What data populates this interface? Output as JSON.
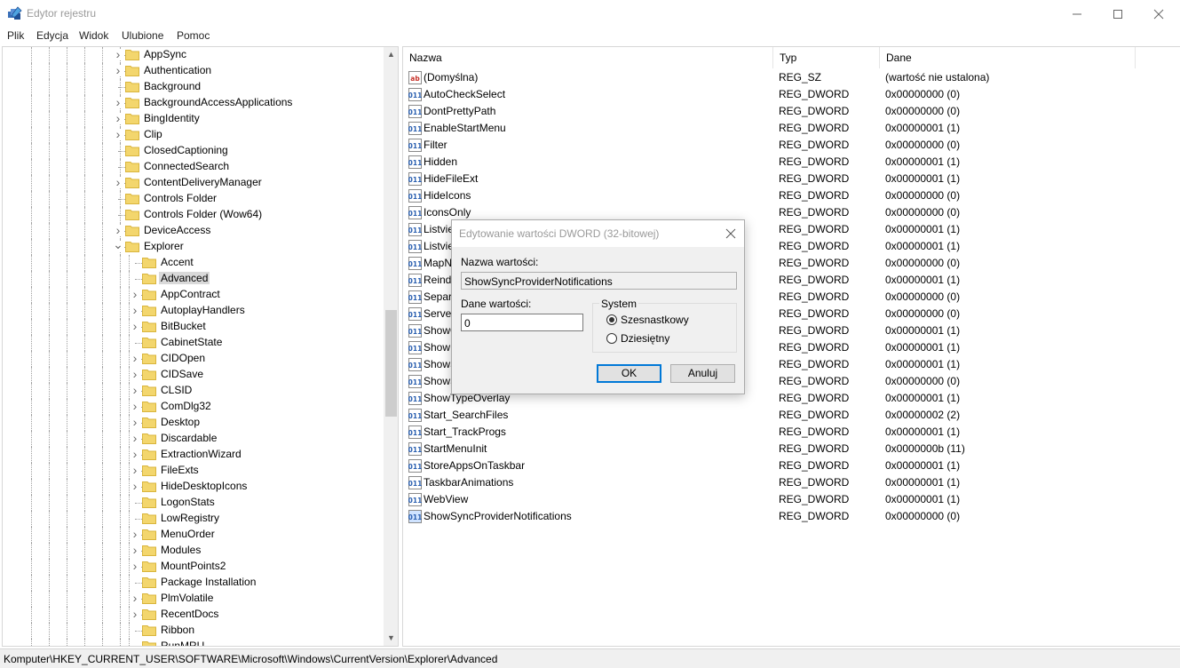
{
  "window": {
    "title": "Edytor rejestru",
    "controls": {
      "minimize_icon": "minimize-icon",
      "maximize_icon": "maximize-icon",
      "close_icon": "close-icon"
    }
  },
  "menu": [
    "Plik",
    "Edycja",
    "Widok",
    "Ulubione",
    "Pomoc"
  ],
  "tree": {
    "items": [
      {
        "label": "AppSync",
        "level": 0,
        "expander": "collapsed"
      },
      {
        "label": "Authentication",
        "level": 0,
        "expander": "collapsed"
      },
      {
        "label": "Background",
        "level": 0,
        "expander": "none"
      },
      {
        "label": "BackgroundAccessApplications",
        "level": 0,
        "expander": "collapsed"
      },
      {
        "label": "BingIdentity",
        "level": 0,
        "expander": "collapsed"
      },
      {
        "label": "Clip",
        "level": 0,
        "expander": "collapsed"
      },
      {
        "label": "ClosedCaptioning",
        "level": 0,
        "expander": "none"
      },
      {
        "label": "ConnectedSearch",
        "level": 0,
        "expander": "none"
      },
      {
        "label": "ContentDeliveryManager",
        "level": 0,
        "expander": "collapsed"
      },
      {
        "label": "Controls Folder",
        "level": 0,
        "expander": "none"
      },
      {
        "label": "Controls Folder (Wow64)",
        "level": 0,
        "expander": "none"
      },
      {
        "label": "DeviceAccess",
        "level": 0,
        "expander": "collapsed"
      },
      {
        "label": "Explorer",
        "level": 0,
        "expander": "expanded"
      },
      {
        "label": "Accent",
        "level": 1,
        "expander": "none"
      },
      {
        "label": "Advanced",
        "level": 1,
        "expander": "none",
        "selected": true
      },
      {
        "label": "AppContract",
        "level": 1,
        "expander": "collapsed"
      },
      {
        "label": "AutoplayHandlers",
        "level": 1,
        "expander": "collapsed"
      },
      {
        "label": "BitBucket",
        "level": 1,
        "expander": "collapsed"
      },
      {
        "label": "CabinetState",
        "level": 1,
        "expander": "none"
      },
      {
        "label": "CIDOpen",
        "level": 1,
        "expander": "collapsed"
      },
      {
        "label": "CIDSave",
        "level": 1,
        "expander": "collapsed"
      },
      {
        "label": "CLSID",
        "level": 1,
        "expander": "collapsed"
      },
      {
        "label": "ComDlg32",
        "level": 1,
        "expander": "collapsed"
      },
      {
        "label": "Desktop",
        "level": 1,
        "expander": "collapsed"
      },
      {
        "label": "Discardable",
        "level": 1,
        "expander": "collapsed"
      },
      {
        "label": "ExtractionWizard",
        "level": 1,
        "expander": "collapsed"
      },
      {
        "label": "FileExts",
        "level": 1,
        "expander": "collapsed"
      },
      {
        "label": "HideDesktopIcons",
        "level": 1,
        "expander": "collapsed"
      },
      {
        "label": "LogonStats",
        "level": 1,
        "expander": "none"
      },
      {
        "label": "LowRegistry",
        "level": 1,
        "expander": "none"
      },
      {
        "label": "MenuOrder",
        "level": 1,
        "expander": "collapsed"
      },
      {
        "label": "Modules",
        "level": 1,
        "expander": "collapsed"
      },
      {
        "label": "MountPoints2",
        "level": 1,
        "expander": "collapsed"
      },
      {
        "label": "Package Installation",
        "level": 1,
        "expander": "none"
      },
      {
        "label": "PlmVolatile",
        "level": 1,
        "expander": "collapsed"
      },
      {
        "label": "RecentDocs",
        "level": 1,
        "expander": "collapsed"
      },
      {
        "label": "Ribbon",
        "level": 1,
        "expander": "none"
      },
      {
        "label": "RunMRU",
        "level": 1,
        "expander": "none"
      }
    ],
    "scroll_up_icon": "scroll-up-arrow-icon",
    "scroll_down_icon": "scroll-down-arrow-icon"
  },
  "list": {
    "columns": {
      "name": "Nazwa",
      "type": "Typ",
      "data": "Dane"
    },
    "rows": [
      {
        "name": "(Domyślna)",
        "type": "REG_SZ",
        "data": "(wartość nie ustalona)",
        "icon": "string-value-icon"
      },
      {
        "name": "AutoCheckSelect",
        "type": "REG_DWORD",
        "data": "0x00000000 (0)",
        "icon": "binary-value-icon"
      },
      {
        "name": "DontPrettyPath",
        "type": "REG_DWORD",
        "data": "0x00000000 (0)",
        "icon": "binary-value-icon"
      },
      {
        "name": "EnableStartMenu",
        "type": "REG_DWORD",
        "data": "0x00000001 (1)",
        "icon": "binary-value-icon"
      },
      {
        "name": "Filter",
        "type": "REG_DWORD",
        "data": "0x00000000 (0)",
        "icon": "binary-value-icon"
      },
      {
        "name": "Hidden",
        "type": "REG_DWORD",
        "data": "0x00000001 (1)",
        "icon": "binary-value-icon"
      },
      {
        "name": "HideFileExt",
        "type": "REG_DWORD",
        "data": "0x00000001 (1)",
        "icon": "binary-value-icon"
      },
      {
        "name": "HideIcons",
        "type": "REG_DWORD",
        "data": "0x00000000 (0)",
        "icon": "binary-value-icon"
      },
      {
        "name": "IconsOnly",
        "type": "REG_DWORD",
        "data": "0x00000000 (0)",
        "icon": "binary-value-icon"
      },
      {
        "name": "Listvie",
        "type": "REG_DWORD",
        "data": "0x00000001 (1)",
        "icon": "binary-value-icon"
      },
      {
        "name": "Listvie",
        "type": "REG_DWORD",
        "data": "0x00000001 (1)",
        "icon": "binary-value-icon"
      },
      {
        "name": "MapN",
        "type": "REG_DWORD",
        "data": "0x00000000 (0)",
        "icon": "binary-value-icon"
      },
      {
        "name": "Reind",
        "type": "REG_DWORD",
        "data": "0x00000001 (1)",
        "icon": "binary-value-icon"
      },
      {
        "name": "Separa",
        "type": "REG_DWORD",
        "data": "0x00000000 (0)",
        "icon": "binary-value-icon"
      },
      {
        "name": "Server",
        "type": "REG_DWORD",
        "data": "0x00000000 (0)",
        "icon": "binary-value-icon"
      },
      {
        "name": "ShowC",
        "type": "REG_DWORD",
        "data": "0x00000001 (1)",
        "icon": "binary-value-icon"
      },
      {
        "name": "ShowI",
        "type": "REG_DWORD",
        "data": "0x00000001 (1)",
        "icon": "binary-value-icon"
      },
      {
        "name": "ShowS",
        "type": "REG_DWORD",
        "data": "0x00000001 (1)",
        "icon": "binary-value-icon"
      },
      {
        "name": "ShowS",
        "type": "REG_DWORD",
        "data": "0x00000000 (0)",
        "icon": "binary-value-icon"
      },
      {
        "name": "ShowTypeOverlay",
        "type": "REG_DWORD",
        "data": "0x00000001 (1)",
        "icon": "binary-value-icon"
      },
      {
        "name": "Start_SearchFiles",
        "type": "REG_DWORD",
        "data": "0x00000002 (2)",
        "icon": "binary-value-icon"
      },
      {
        "name": "Start_TrackProgs",
        "type": "REG_DWORD",
        "data": "0x00000001 (1)",
        "icon": "binary-value-icon"
      },
      {
        "name": "StartMenuInit",
        "type": "REG_DWORD",
        "data": "0x0000000b (11)",
        "icon": "binary-value-icon"
      },
      {
        "name": "StoreAppsOnTaskbar",
        "type": "REG_DWORD",
        "data": "0x00000001 (1)",
        "icon": "binary-value-icon"
      },
      {
        "name": "TaskbarAnimations",
        "type": "REG_DWORD",
        "data": "0x00000001 (1)",
        "icon": "binary-value-icon"
      },
      {
        "name": "WebView",
        "type": "REG_DWORD",
        "data": "0x00000001 (1)",
        "icon": "binary-value-icon"
      },
      {
        "name": "ShowSyncProviderNotifications",
        "type": "REG_DWORD",
        "data": "0x00000000 (0)",
        "icon": "binary-value-icon",
        "highlighted_icon": true
      }
    ]
  },
  "status": {
    "path": "Komputer\\HKEY_CURRENT_USER\\SOFTWARE\\Microsoft\\Windows\\CurrentVersion\\Explorer\\Advanced"
  },
  "dialog": {
    "title": "Edytowanie wartości DWORD (32-bitowej)",
    "value_name_label": "Nazwa wartości:",
    "value_name": "ShowSyncProviderNotifications",
    "value_data_label": "Dane wartości:",
    "value_data": "0",
    "base_group_label": "System",
    "base_options": [
      "Szesnastkowy",
      "Dziesiętny"
    ],
    "base_selected": "Szesnastkowy",
    "ok_label": "OK",
    "cancel_label": "Anuluj"
  },
  "colors": {
    "folder": "#f3d66d",
    "folder_edge": "#d9b53c",
    "selection": "#d9d9d9",
    "default_button_border": "#0078d7",
    "value_icon_blue": "#2a5fb0",
    "value_icon_red": "#c8332b"
  }
}
